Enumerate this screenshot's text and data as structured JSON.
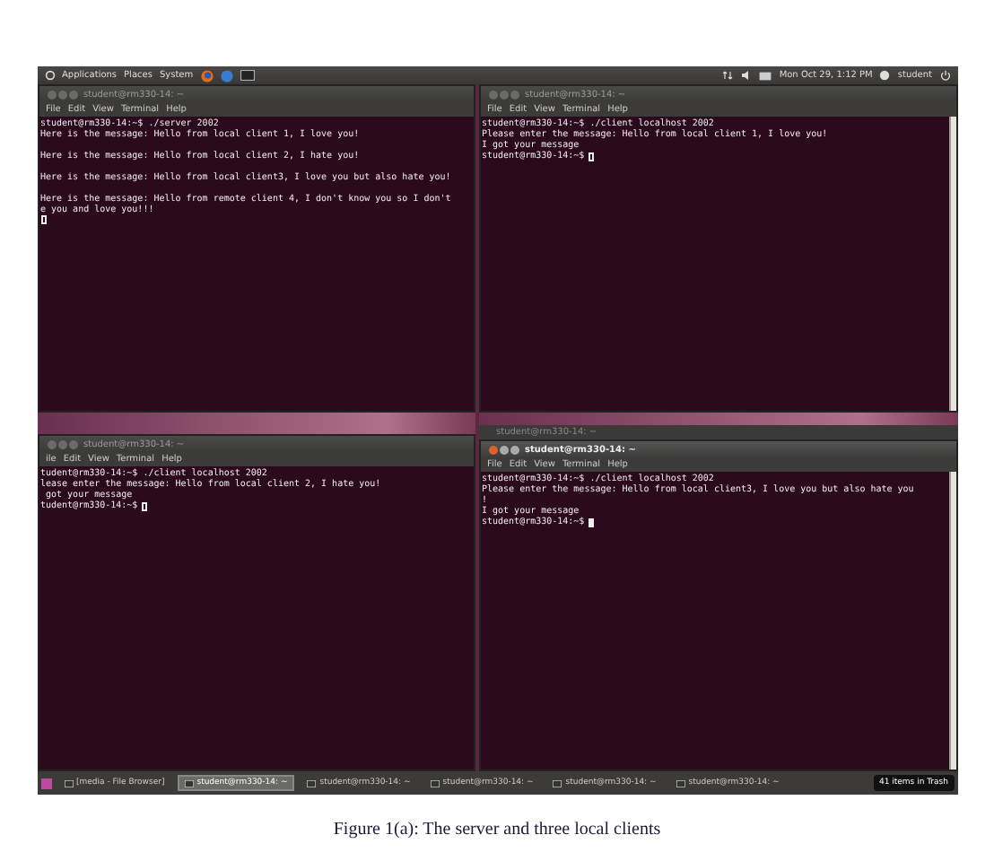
{
  "top_panel": {
    "menus": [
      "Applications",
      "Places",
      "System"
    ],
    "clock": "Mon Oct 29,  1:12 PM",
    "user": "student"
  },
  "terminals": [
    {
      "title": "student@rm330-14: ~",
      "menu": [
        "File",
        "Edit",
        "View",
        "Terminal",
        "Help"
      ],
      "active": false,
      "cursor_on_new_line": true,
      "paragraphs": [
        [
          "student@rm330-14:~$ ./server 2002",
          "Here is the message: Hello from local client 1, I love you!"
        ],
        [
          "Here is the message: Hello from local client 2, I hate you!"
        ],
        [
          "Here is the message: Hello from local client3, I love you but also hate you!"
        ],
        [
          "Here is the message: Hello from remote client 4, I don't know you so I don't",
          "e you and love you!!!"
        ]
      ]
    },
    {
      "title": "student@rm330-14: ~",
      "menu": [
        "File",
        "Edit",
        "View",
        "Terminal",
        "Help"
      ],
      "active": false,
      "cursor_on_new_line": false,
      "paragraphs": [
        [
          "student@rm330-14:~$ ./client localhost 2002",
          "Please enter the message: Hello from local client 1, I love you!",
          "I got your message",
          "student@rm330-14:~$"
        ]
      ]
    },
    {
      "title": "student@rm330-14: ~",
      "menu": [
        "ile",
        "Edit",
        "View",
        "Terminal",
        "Help"
      ],
      "active": false,
      "cursor_on_new_line": false,
      "paragraphs": [
        [
          "tudent@rm330-14:~$ ./client localhost 2002",
          "lease enter the message: Hello from local client 2, I hate you!",
          " got your message",
          "tudent@rm330-14:~$"
        ]
      ]
    },
    {
      "title": "student@rm330-14: ~",
      "menu": [
        "File",
        "Edit",
        "View",
        "Terminal",
        "Help"
      ],
      "active": true,
      "cursor_on_new_line": false,
      "paragraphs": [
        [
          "student@rm330-14:~$ ./client localhost 2002",
          "Please enter the message: Hello from local client3, I love you but also hate you",
          "!",
          "I got your message",
          "student@rm330-14:~$"
        ]
      ]
    }
  ],
  "background_window": {
    "title": "student@rm330-14: ~"
  },
  "taskbar": {
    "items": [
      {
        "label": "[media - File Browser]",
        "selected": false
      },
      {
        "label": "student@rm330-14: ~",
        "selected": true
      },
      {
        "label": "student@rm330-14: ~",
        "selected": false
      },
      {
        "label": "student@rm330-14: ~",
        "selected": false
      },
      {
        "label": "student@rm330-14: ~",
        "selected": false
      },
      {
        "label": "student@rm330-14: ~",
        "selected": false
      }
    ],
    "trash_tooltip": "41 items in Trash"
  },
  "caption": "Figure 1(a): The server and three local clients"
}
